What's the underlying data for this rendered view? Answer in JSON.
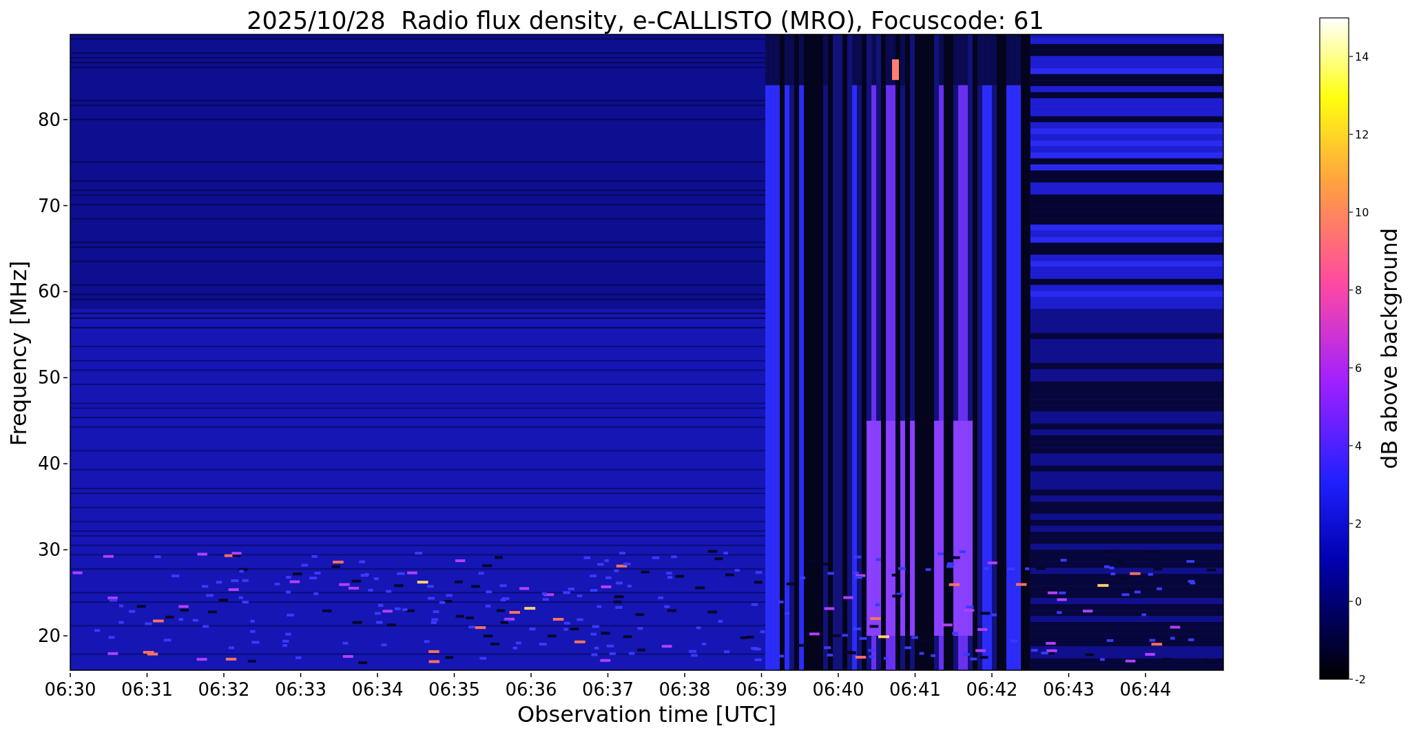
{
  "title": "2025/10/28  Radio flux density, e-CALLISTO (MRO), Focuscode: 61",
  "plot": {
    "ylabel": "Frequency [MHz]",
    "xlabel": "Observation time [UTC]",
    "yticks": [
      "80",
      "70",
      "60",
      "50",
      "40",
      "30",
      "20"
    ],
    "xticks": [
      "06:30",
      "06:31",
      "06:32",
      "06:33",
      "06:34",
      "06:35",
      "06:36",
      "06:37",
      "06:38",
      "06:39",
      "06:40",
      "06:41",
      "06:42",
      "06:43",
      "06:44"
    ]
  },
  "colorbar": {
    "label": "dB above background",
    "ticks": [
      "14",
      "12",
      "10",
      "8",
      "6",
      "4",
      "2",
      "0",
      "-2"
    ]
  }
}
